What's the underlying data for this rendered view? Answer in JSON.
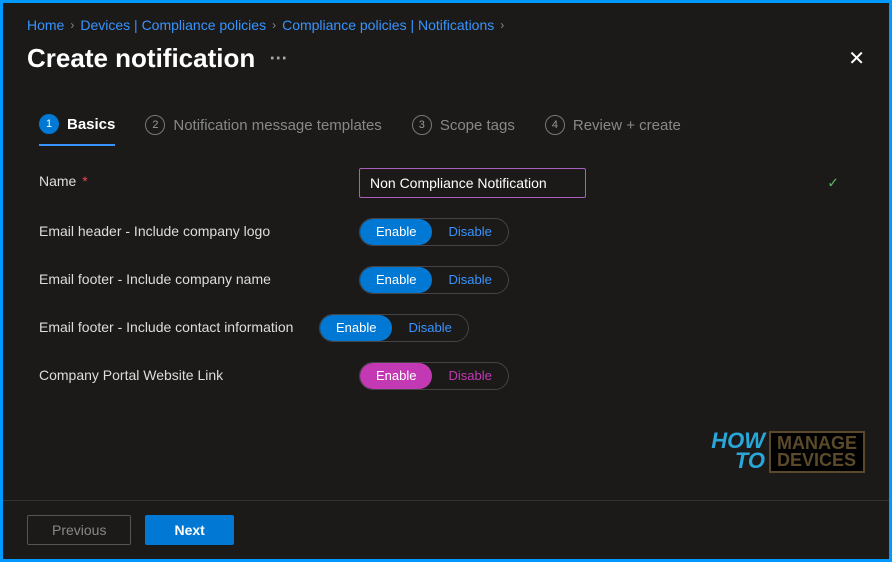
{
  "breadcrumb": [
    "Home",
    "Devices | Compliance policies",
    "Compliance policies | Notifications"
  ],
  "title": "Create notification",
  "tabs": [
    {
      "num": "1",
      "label": "Basics",
      "active": true
    },
    {
      "num": "2",
      "label": "Notification message templates",
      "active": false
    },
    {
      "num": "3",
      "label": "Scope tags",
      "active": false
    },
    {
      "num": "4",
      "label": "Review + create",
      "active": false
    }
  ],
  "fields": {
    "name_label": "Name",
    "name_value": "Non Compliance Notification",
    "toggles": [
      {
        "label": "Email header - Include company logo",
        "on": "Enable",
        "off": "Disable",
        "style": "blue"
      },
      {
        "label": "Email footer - Include company name",
        "on": "Enable",
        "off": "Disable",
        "style": "blue"
      },
      {
        "label": "Email footer - Include contact information",
        "on": "Enable",
        "off": "Disable",
        "style": "blue"
      },
      {
        "label": "Company Portal Website Link",
        "on": "Enable",
        "off": "Disable",
        "style": "alt"
      }
    ]
  },
  "footer": {
    "previous": "Previous",
    "next": "Next"
  },
  "watermark": {
    "how": "HOW",
    "to": "TO",
    "manage": "MANAGE",
    "devices": "DEVICES"
  }
}
